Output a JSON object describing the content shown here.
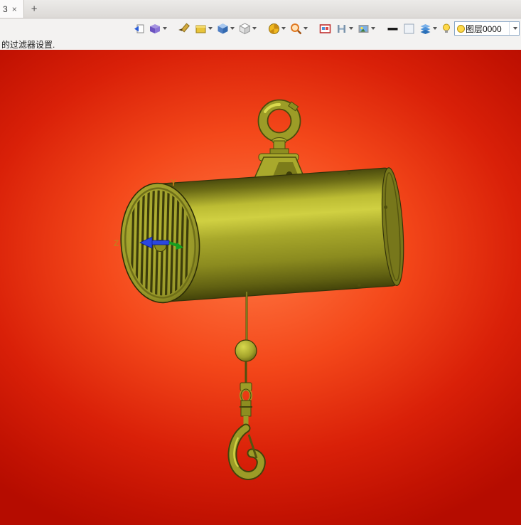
{
  "tabs": {
    "active_label": "3",
    "close_label": "×",
    "new_tab_label": "+"
  },
  "toolbar": {
    "icon_names": [
      "import-view-icon",
      "component-box-icon",
      "pencil-icon",
      "material-box-icon",
      "view-cube-icon",
      "display-style-cube-icon",
      "section-wheel-icon",
      "zoom-magnifier-icon",
      "image-frame-icon",
      "dimension-h-icon",
      "scene-view-icon",
      "line-weight-icon",
      "blank-swatch-icon",
      "layers-icon",
      "light-bulb-icon",
      "layer-bulb-icon"
    ],
    "layer_combo": {
      "value": "图层0000"
    }
  },
  "status": {
    "message": "的过滤器设置."
  },
  "viewport": {
    "axis_y_label": "Y",
    "axis_z_label": "Z",
    "background_center_color": "#ff7a45",
    "background_edge_color": "#b50c00",
    "model_color": "#9c9c27"
  }
}
